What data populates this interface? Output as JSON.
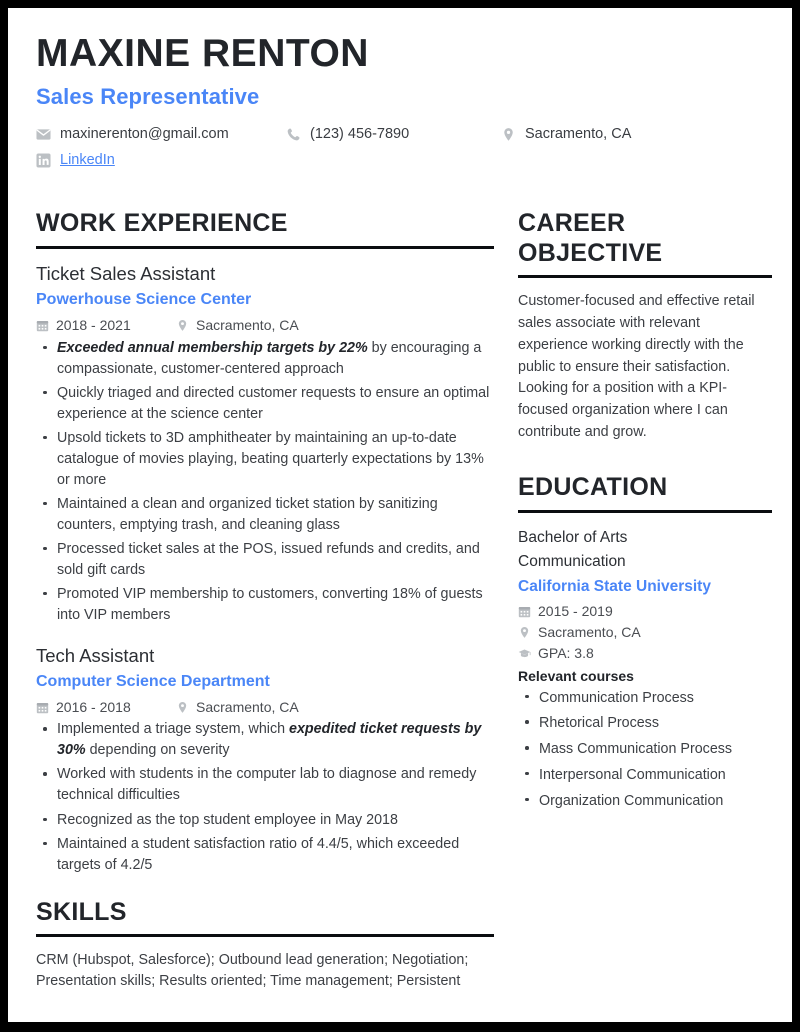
{
  "header": {
    "name": "MAXINE RENTON",
    "job_title": "Sales Representative",
    "accent_color": "#4a86f7",
    "contacts": [
      {
        "icon": "envelope-icon",
        "text": "maxinerenton@gmail.com",
        "link": false
      },
      {
        "icon": "phone-icon",
        "text": "(123) 456-7890",
        "link": false
      },
      {
        "icon": "map-pin-icon",
        "text": "Sacramento, CA",
        "link": false
      },
      {
        "icon": "linkedin-icon",
        "text": "LinkedIn",
        "link": true
      }
    ]
  },
  "work_experience": {
    "title": "WORK EXPERIENCE",
    "jobs": [
      {
        "role": "Ticket Sales Assistant",
        "org": "Powerhouse Science Center",
        "dates": "2018 - 2021",
        "location": "Sacramento, CA",
        "bullets": [
          {
            "bold": "Exceeded annual membership targets by 22%",
            "rest": " by encouraging a compassionate, customer-centered approach"
          },
          {
            "bold": "",
            "rest": "Quickly triaged and directed customer requests to ensure an optimal experience at the science center"
          },
          {
            "bold": "",
            "rest": "Upsold tickets to 3D amphitheater by maintaining an up-to-date catalogue of movies playing, beating quarterly expectations by 13% or more"
          },
          {
            "bold": "",
            "rest": "Maintained a clean and organized ticket station by sanitizing counters, emptying trash, and cleaning glass"
          },
          {
            "bold": "",
            "rest": "Processed ticket sales at the POS, issued refunds and credits, and sold gift cards"
          },
          {
            "bold": "",
            "rest": "Promoted VIP membership to customers, converting 18% of guests into VIP members"
          }
        ]
      },
      {
        "role": "Tech Assistant",
        "org": "Computer Science Department",
        "dates": "2016 - 2018",
        "location": "Sacramento, CA",
        "bullets": [
          {
            "pre": "Implemented a triage system, which ",
            "bold": "expedited ticket requests by 30%",
            "rest": " depending on severity"
          },
          {
            "bold": "",
            "rest": "Worked with students in the computer lab to diagnose and remedy technical difficulties"
          },
          {
            "bold": "",
            "rest": "Recognized as the top student employee in May 2018"
          },
          {
            "bold": "",
            "rest": "Maintained a student satisfaction ratio of 4.4/5, which exceeded targets of 4.2/5"
          }
        ]
      }
    ]
  },
  "skills": {
    "title": "SKILLS",
    "text": "CRM (Hubspot, Salesforce); Outbound lead generation; Negotiation; Presentation skills; Results oriented; Time management; Persistent"
  },
  "career_objective": {
    "title": "CAREER OBJECTIVE",
    "text": "Customer-focused and effective retail sales associate with relevant experience working directly with the public to ensure their satisfaction. Looking for a position with a KPI-focused organization where I can contribute and grow."
  },
  "education": {
    "title": "EDUCATION",
    "degree_line1": "Bachelor of Arts",
    "degree_line2": "Communication",
    "school": "California State University",
    "dates": "2015 - 2019",
    "location": "Sacramento, CA",
    "gpa": "GPA: 3.8",
    "relevant_courses_title": "Relevant courses",
    "relevant_courses": [
      "Communication Process",
      "Rhetorical Process",
      "Mass Communication Process",
      "Interpersonal Communication",
      "Organization Communication"
    ]
  }
}
